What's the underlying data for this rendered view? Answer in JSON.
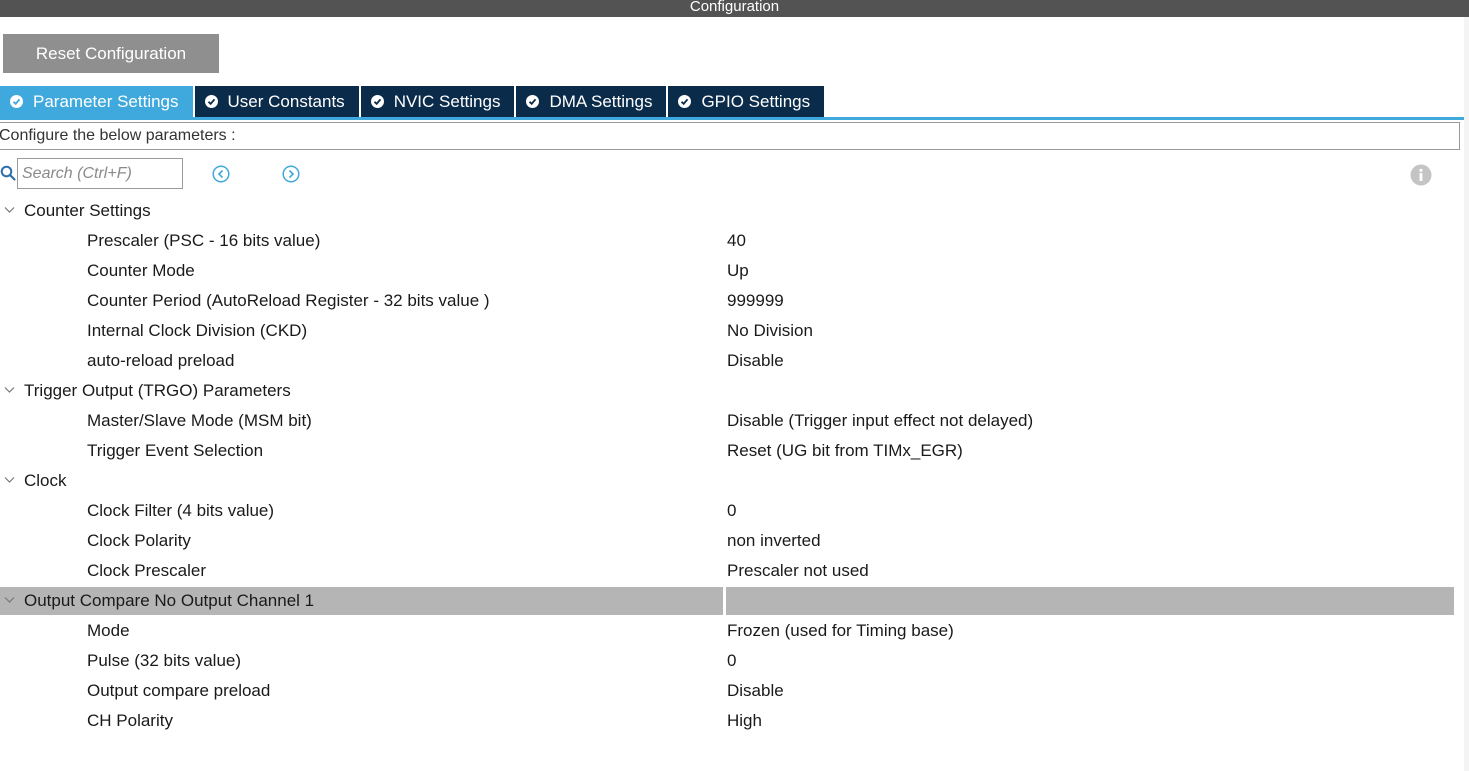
{
  "window": {
    "title": "Configuration"
  },
  "toolbar": {
    "reset_label": "Reset Configuration"
  },
  "tabs": [
    {
      "label": "Parameter Settings",
      "active": true
    },
    {
      "label": "User Constants",
      "active": false
    },
    {
      "label": "NVIC Settings",
      "active": false
    },
    {
      "label": "DMA Settings",
      "active": false
    },
    {
      "label": "GPIO Settings",
      "active": false
    }
  ],
  "description": "Configure the below parameters :",
  "search": {
    "placeholder": "Search (Ctrl+F)",
    "value": ""
  },
  "groups": [
    {
      "name": "Counter Settings",
      "params": [
        {
          "name": "Prescaler (PSC - 16 bits value)",
          "value": "40"
        },
        {
          "name": "Counter Mode",
          "value": "Up"
        },
        {
          "name": "Counter Period (AutoReload Register - 32 bits value )",
          "value": "999999"
        },
        {
          "name": "Internal Clock Division (CKD)",
          "value": "No Division"
        },
        {
          "name": "auto-reload preload",
          "value": "Disable"
        }
      ]
    },
    {
      "name": "Trigger Output (TRGO) Parameters",
      "params": [
        {
          "name": "Master/Slave Mode (MSM bit)",
          "value": "Disable (Trigger input effect not delayed)"
        },
        {
          "name": "Trigger Event Selection",
          "value": "Reset (UG bit from TIMx_EGR)"
        }
      ]
    },
    {
      "name": "Clock",
      "params": [
        {
          "name": "Clock Filter (4 bits value)",
          "value": "0"
        },
        {
          "name": "Clock Polarity",
          "value": "non inverted"
        },
        {
          "name": "Clock Prescaler",
          "value": "Prescaler not used"
        }
      ]
    },
    {
      "name": "Output Compare No Output Channel 1",
      "selected": true,
      "params": [
        {
          "name": "Mode",
          "value": "Frozen (used for Timing base)"
        },
        {
          "name": "Pulse (32 bits value)",
          "value": "0"
        },
        {
          "name": "Output compare preload",
          "value": "Disable"
        },
        {
          "name": "CH Polarity",
          "value": "High"
        }
      ]
    }
  ],
  "colors": {
    "title_bar": "#535353",
    "tab_inactive": "#0b2b4b",
    "tab_active": "#3fa9dd",
    "selected_row": "#b5b5b5",
    "reset_button": "#8f8f8f"
  },
  "icons": {
    "tab_status": "check-circle-icon",
    "search": "search-icon",
    "previous": "previous-icon",
    "next": "next-icon",
    "info": "info-icon",
    "group_toggle": "chevron-down-icon"
  }
}
